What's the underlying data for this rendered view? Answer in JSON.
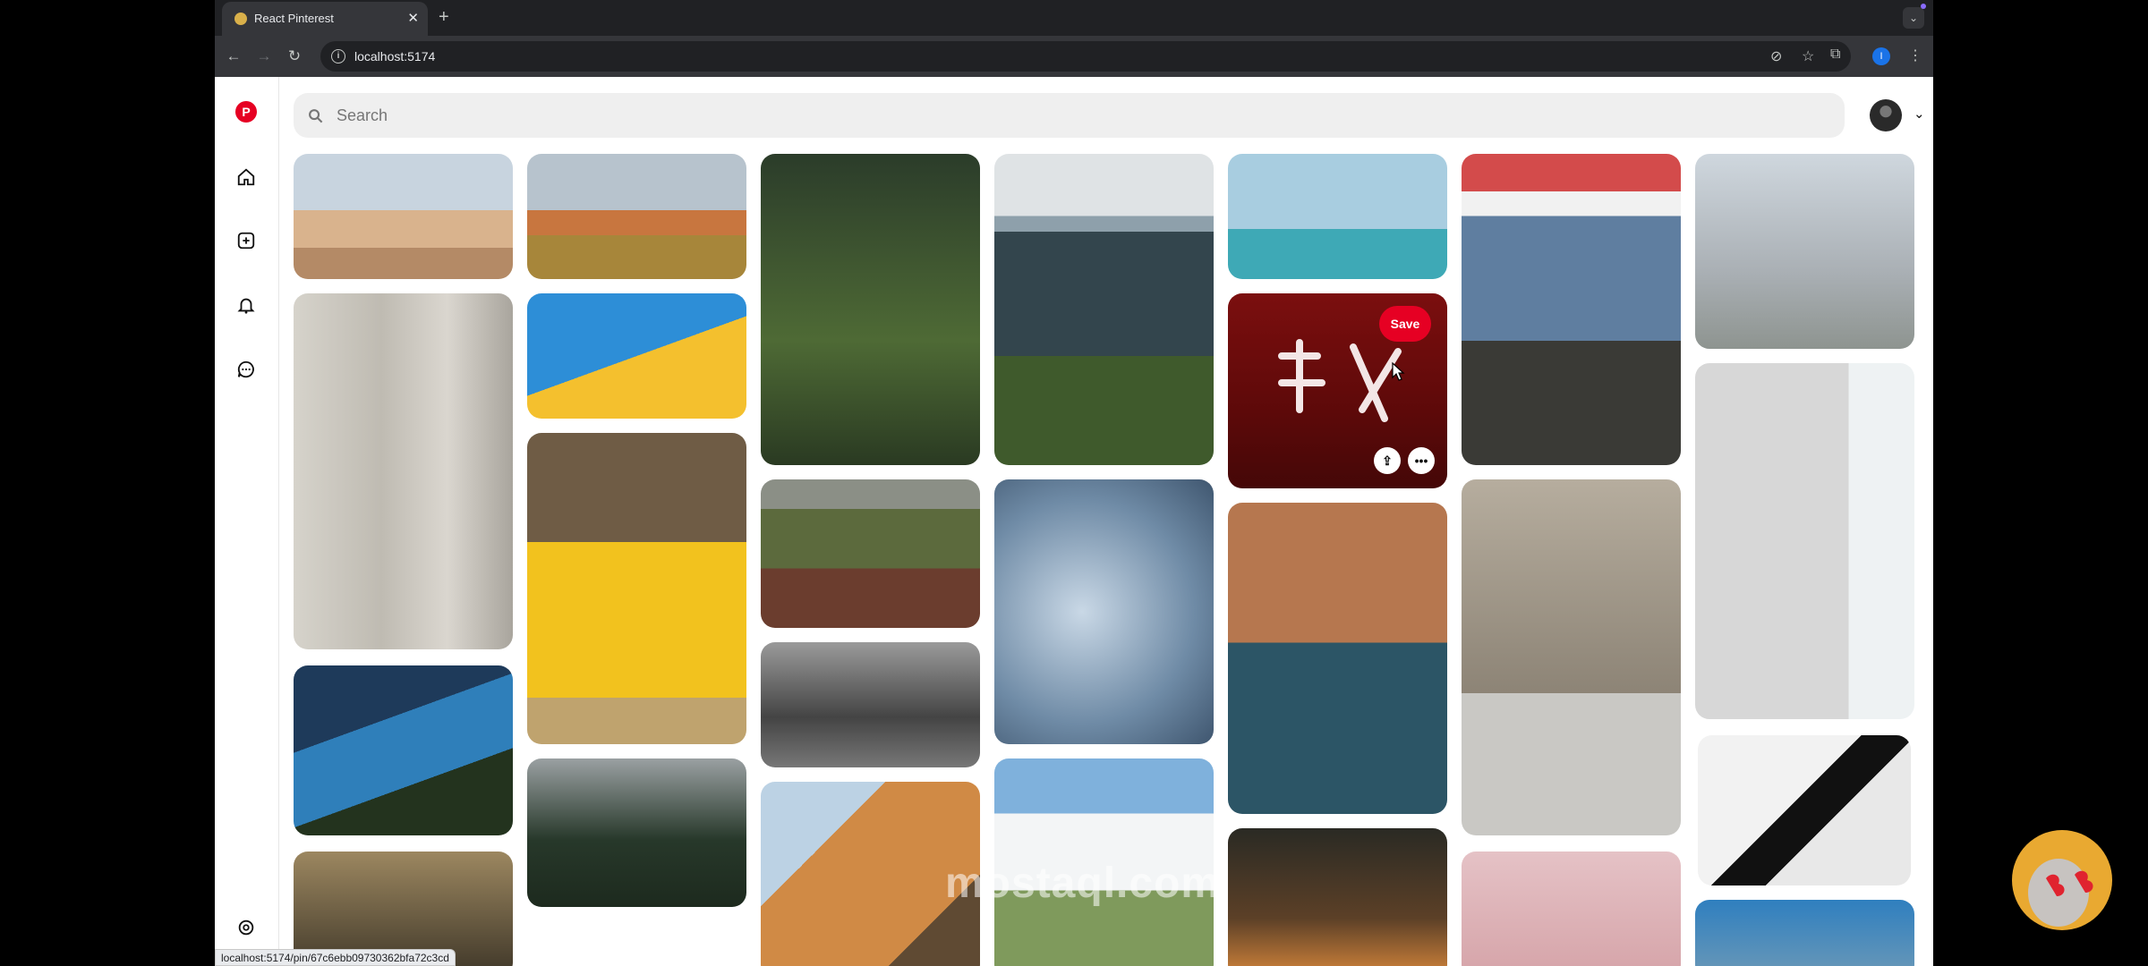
{
  "browser": {
    "tab_title": "React Pinterest",
    "url": "localhost:5174",
    "status_url": "localhost:5174/pin/67c6ebb09730362bfa72c3cd",
    "profile_initial": "I"
  },
  "search": {
    "placeholder": "Search"
  },
  "sidebar": {
    "items": [
      {
        "icon": "home-icon"
      },
      {
        "icon": "create-icon"
      },
      {
        "icon": "bell-icon"
      },
      {
        "icon": "message-icon"
      }
    ],
    "bottom_icon": "settings-icon"
  },
  "hovered_pin": {
    "save_label": "Save"
  },
  "watermark": "mostaql.com",
  "colors": {
    "brand": "#e60023",
    "search_bg": "#efefef"
  }
}
